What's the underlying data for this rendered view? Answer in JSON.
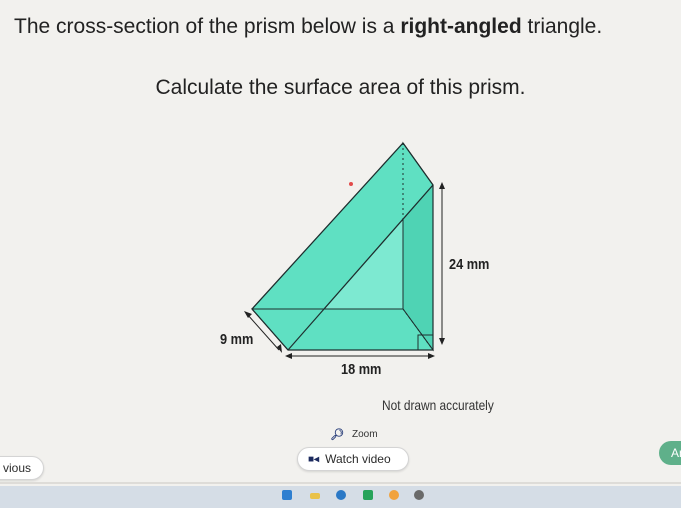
{
  "question": {
    "title_pre": "The cross-section of the prism below is a ",
    "title_bold": "right-angled",
    "title_post": " triangle.",
    "instruction": "Calculate the surface area of this prism."
  },
  "diagram": {
    "height_label": "24 mm",
    "depth_label": "9 mm",
    "width_label": "18 mm",
    "fill_color": "#5fe0c2",
    "note": "Not drawn accurately"
  },
  "toolbar": {
    "zoom_label": "Zoom",
    "watch_video_label": "Watch video",
    "previous_label": "vious",
    "answer_label": "An"
  },
  "taskbar": {
    "icons": [
      "file-explorer-icon",
      "folder-icon",
      "browser-icon",
      "spreadsheet-icon",
      "chrome-icon",
      "settings-icon"
    ]
  }
}
